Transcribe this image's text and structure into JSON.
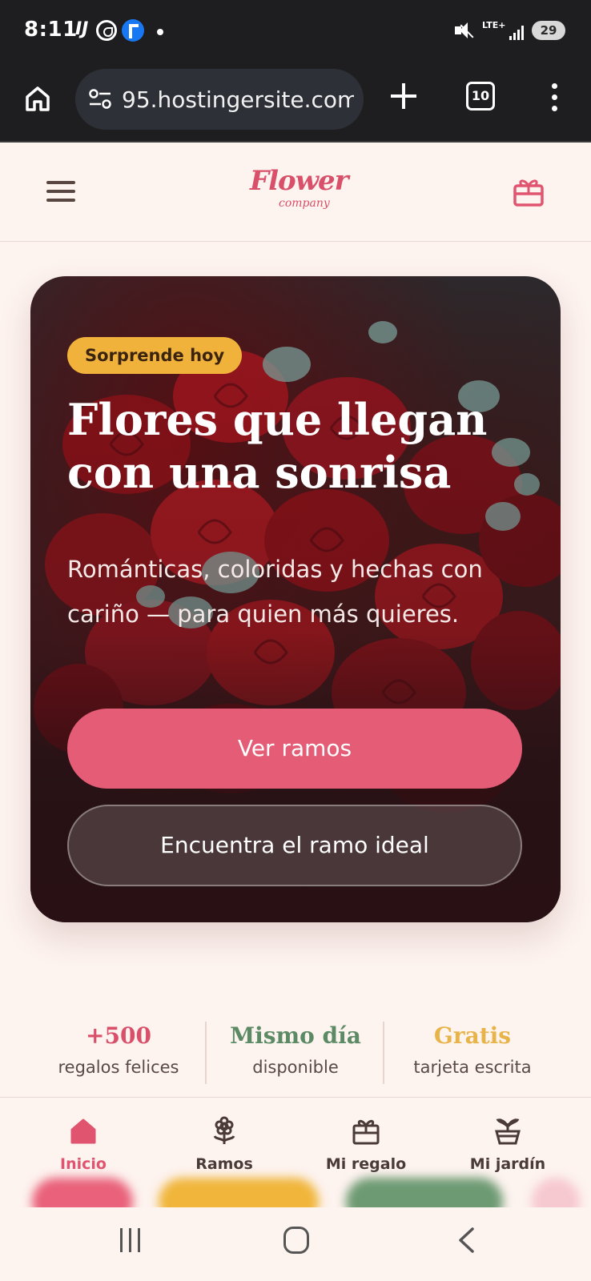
{
  "status_bar": {
    "time": "8:11",
    "notification_glyph": "IJ",
    "network": "LTE+",
    "battery": "29",
    "icons": [
      "whatsapp-icon",
      "facebook-messenger-icon",
      "dot-icon",
      "mute-icon",
      "signal-icon",
      "battery-icon"
    ]
  },
  "browser": {
    "url": "95.hostingersite.com",
    "tab_count": "10"
  },
  "header": {
    "logo_main": "Flower",
    "logo_sub": "company"
  },
  "hero": {
    "badge": "Sorprende hoy",
    "title": "Flores que llegan con una sonrisa",
    "subtitle": "Románticas, coloridas y hechas con cariño — para quien más quieres.",
    "primary_button": "Ver ramos",
    "secondary_button": "Encuentra el ramo ideal"
  },
  "stats": [
    {
      "value": "+500",
      "label": "regalos felices",
      "color": "#d9506a"
    },
    {
      "value": "Mismo día",
      "label": "disponible",
      "color": "#5b8a64"
    },
    {
      "value": "Gratis",
      "label": "tarjeta escrita",
      "color": "#e8b44a"
    }
  ],
  "bottom_nav": [
    {
      "label": "Inicio",
      "icon": "home-icon",
      "active": true
    },
    {
      "label": "Ramos",
      "icon": "flower-icon",
      "active": false
    },
    {
      "label": "Mi regalo",
      "icon": "gift-icon",
      "active": false
    },
    {
      "label": "Mi jardín",
      "icon": "plant-pot-icon",
      "active": false
    }
  ],
  "colors": {
    "accent": "#e45c75",
    "badge": "#f1b23c",
    "page_bg": "#fdf3ef",
    "chrome_bg": "#1e1e20"
  }
}
